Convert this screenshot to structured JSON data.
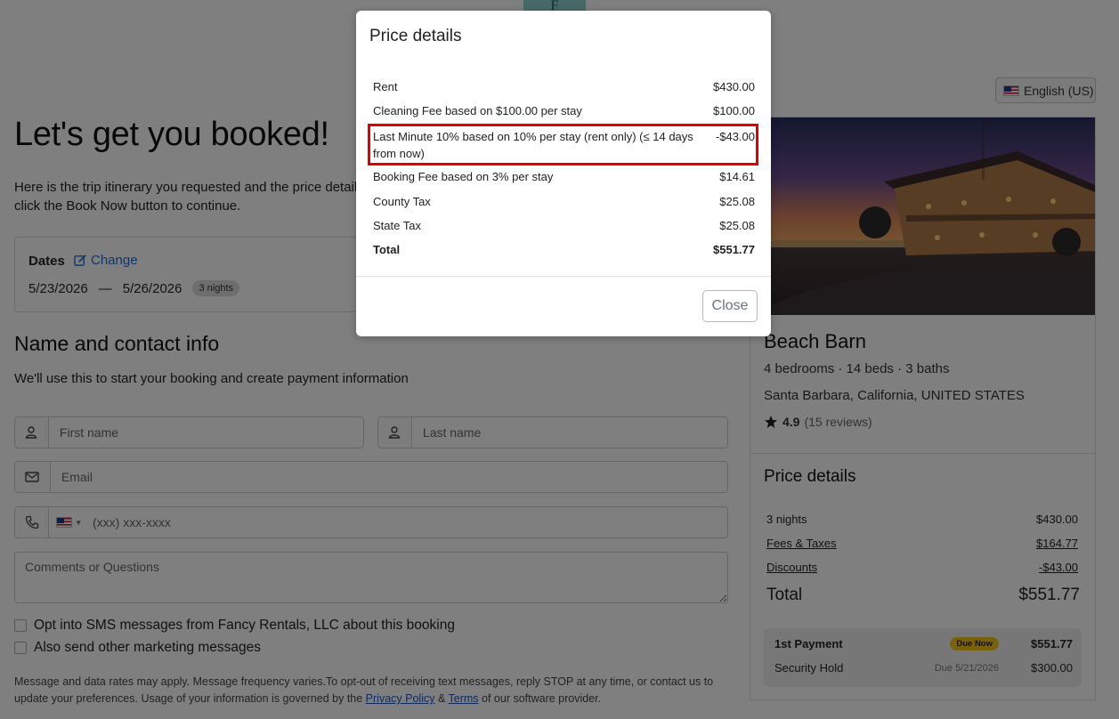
{
  "header": {
    "logo_text": "F",
    "language_label": "English (US)"
  },
  "main": {
    "title": "Let's get you booked!",
    "intro": "Here is the trip itinerary you requested and the price detail click the Book Now button to continue.",
    "dates": {
      "label": "Dates",
      "change_label": "Change",
      "start": "5/23/2026",
      "separator": "—",
      "end": "5/26/2026",
      "nights": "3 nights"
    },
    "contact": {
      "heading": "Name and contact info",
      "subheading": "We'll use this to start your booking and create payment information",
      "first_name_placeholder": "First name",
      "last_name_placeholder": "Last name",
      "email_placeholder": "Email",
      "phone_placeholder": "(xxx) xxx-xxxx",
      "comments_placeholder": "Comments or Questions",
      "sms_opt_in": "Opt into SMS messages from Fancy Rentals, LLC about this booking",
      "marketing_opt_in": "Also send other marketing messages",
      "legal_text": "Message and data rates may apply. Message frequency varies.To opt-out of receiving text messages, reply STOP at any time, or contact us to update your preferences. Usage of your information is governed by the ",
      "privacy_link": "Privacy Policy",
      "amp": " & ",
      "terms_link": "Terms",
      "legal_tail": " of our software provider."
    }
  },
  "property": {
    "name": "Beach Barn",
    "meta": "4 bedrooms · 14 beds · 3 baths",
    "location": "Santa Barbara, California, UNITED STATES",
    "rating": "4.9",
    "reviews": "(15 reviews)",
    "price_details": {
      "title": "Price details",
      "nights_label": "3 nights",
      "nights_value": "$430.00",
      "fees_label": "Fees & Taxes",
      "fees_value": "$164.77",
      "discounts_label": "Discounts",
      "discounts_value": "-$43.00",
      "total_label": "Total",
      "total_value": "$551.77"
    },
    "payments": {
      "first_label": "1st Payment",
      "first_badge": "Due Now",
      "first_value": "$551.77",
      "hold_label": "Security Hold",
      "hold_date": "Due 5/21/2026",
      "hold_value": "$300.00"
    }
  },
  "modal": {
    "title": "Price details",
    "rows": [
      {
        "label": "Rent",
        "value": "$430.00"
      },
      {
        "label": "Cleaning Fee based on $100.00 per stay",
        "value": "$100.00"
      },
      {
        "label": "Last Minute 10% based on 10% per stay (rent only) (≤ 14 days from now)",
        "value": "-$43.00"
      },
      {
        "label": "Booking Fee based on 3% per stay",
        "value": "$14.61"
      },
      {
        "label": "County Tax",
        "value": "$25.08"
      },
      {
        "label": "State Tax",
        "value": "$25.08"
      },
      {
        "label": "Total",
        "value": "$551.77"
      }
    ],
    "close_label": "Close"
  },
  "colors": {
    "link": "#1a6fd1",
    "highlight": "#e00000",
    "badge": "#f5c518"
  },
  "icons": [
    "pencil-square-icon",
    "user-icon",
    "envelope-icon",
    "phone-icon",
    "star-icon",
    "us-flag-icon"
  ]
}
